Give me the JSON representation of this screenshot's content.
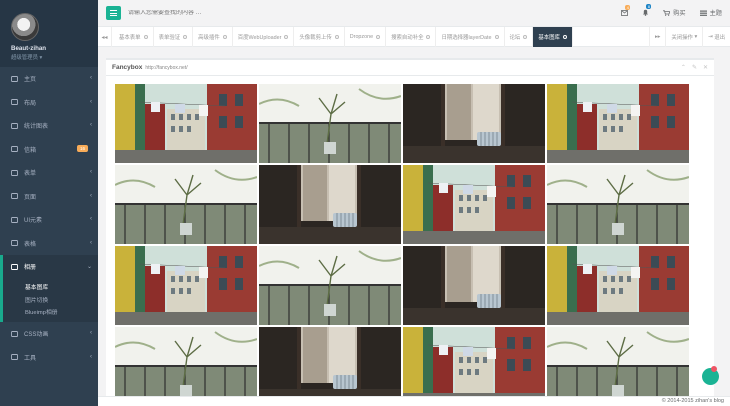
{
  "profile": {
    "name": "Beaut-zihan",
    "role": "超级管理员 ▾"
  },
  "nav": {
    "items": [
      {
        "label": "主页",
        "icon": "home-icon"
      },
      {
        "label": "布局",
        "icon": "columns-icon"
      },
      {
        "label": "统计图表",
        "icon": "chart-icon"
      },
      {
        "label": "信箱",
        "icon": "envelope-icon",
        "badge": "16"
      },
      {
        "label": "表单",
        "icon": "edit-icon"
      },
      {
        "label": "页面",
        "icon": "desktop-icon"
      },
      {
        "label": "UI元素",
        "icon": "flask-icon"
      },
      {
        "label": "表格",
        "icon": "table-icon"
      }
    ],
    "active": {
      "label": "相册",
      "icon": "picture-icon"
    },
    "sub": [
      "基本图库",
      "图片切换",
      "Blueimp相册"
    ],
    "after": [
      {
        "label": "CSS动画",
        "icon": "magic-icon"
      },
      {
        "label": "工具",
        "icon": "cutlery-icon"
      }
    ]
  },
  "header": {
    "search_placeholder": "请输入您需要查找的内容 …",
    "messages_badge": "4",
    "alerts_badge": "8",
    "buy": "购买",
    "theme": "主题"
  },
  "tabs": {
    "items": [
      "基本表单",
      "表单验证",
      "高级插件",
      "百度WebUploader",
      "头像裁剪上传",
      "Dropzone",
      "搜索自动补全",
      "日期选择器layerDate",
      "论坛",
      "基本图库"
    ],
    "active_index": 9,
    "close_ops": "关闭操作",
    "logout": "退出"
  },
  "panel": {
    "title": "Fancybox",
    "url": "http://fancybox.net/"
  },
  "gallery": {
    "images": [
      "street",
      "balcony",
      "window",
      "street",
      "balcony",
      "window",
      "street",
      "balcony",
      "street",
      "balcony",
      "window",
      "street",
      "balcony",
      "window",
      "street",
      "balcony"
    ]
  },
  "footer": {
    "text": "© 2014-2015 zihan's blog"
  },
  "colors": {
    "accent": "#1ab394",
    "sidebar": "#2f4050",
    "badge": "#f8ac59"
  }
}
